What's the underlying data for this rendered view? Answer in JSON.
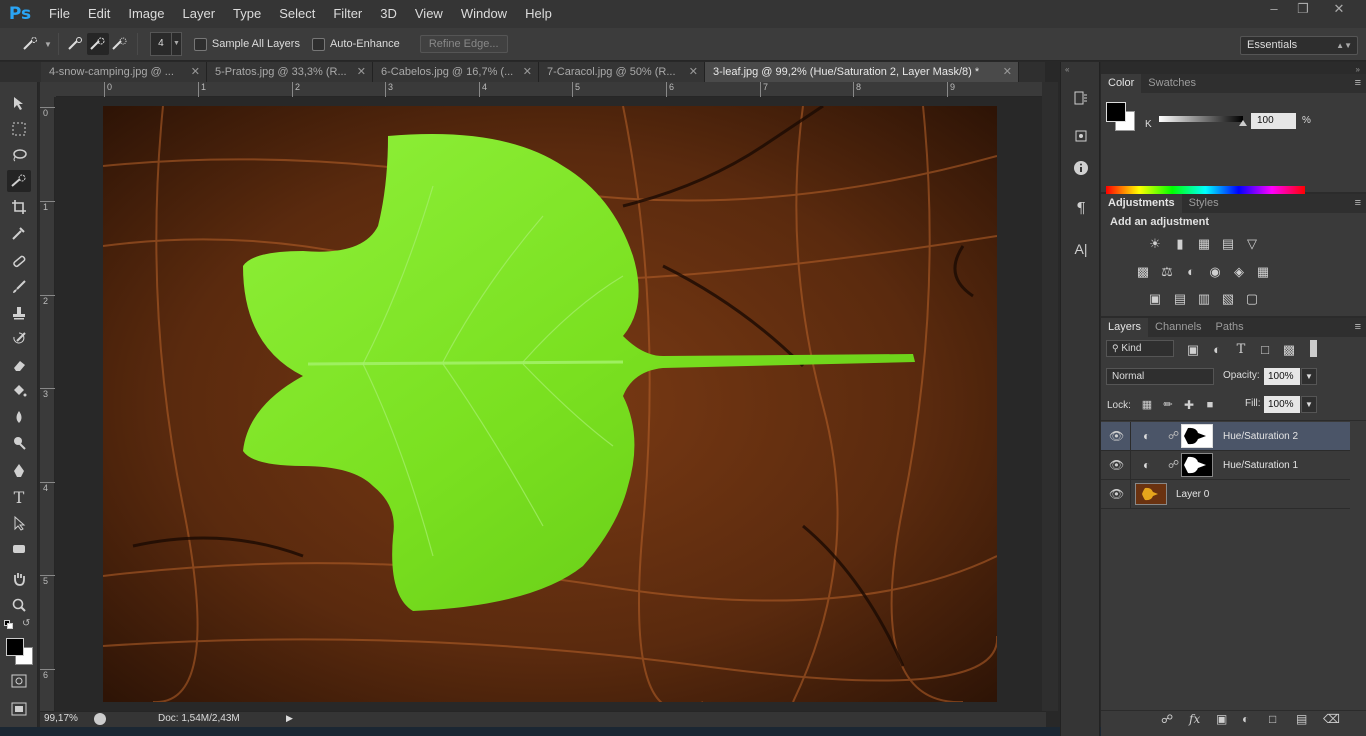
{
  "app": {
    "logo": "Ps"
  },
  "menu": [
    "File",
    "Edit",
    "Image",
    "Layer",
    "Type",
    "Select",
    "Filter",
    "3D",
    "View",
    "Window",
    "Help"
  ],
  "options": {
    "brush_size": "4",
    "sample_all_layers": "Sample All Layers",
    "auto_enhance": "Auto-Enhance",
    "refine_edge": "Refine Edge...",
    "workspace": "Essentials"
  },
  "tabs": [
    {
      "label": "4-snow-camping.jpg @ ..."
    },
    {
      "label": "5-Pratos.jpg @ 33,3% (R..."
    },
    {
      "label": "6-Cabelos.jpg @ 16,7% (..."
    },
    {
      "label": "7-Caracol.jpg @ 50% (R..."
    },
    {
      "label": "3-leaf.jpg @ 99,2% (Hue/Saturation 2, Layer Mask/8) *"
    }
  ],
  "ruler": {
    "h": [
      "0",
      "1",
      "2",
      "3",
      "4",
      "5",
      "6",
      "7",
      "8",
      "9"
    ],
    "v": [
      "0",
      "1",
      "2",
      "3",
      "4",
      "5",
      "6"
    ]
  },
  "status": {
    "zoom": "99,17%",
    "doc": "Doc: 1,54M/2,43M"
  },
  "color_panel": {
    "tabs": [
      "Color",
      "Swatches"
    ],
    "channel": "K",
    "value": "100",
    "unit": "%",
    "fg": "#000000",
    "bg": "#ffffff"
  },
  "adjust_panel": {
    "tabs": [
      "Adjustments",
      "Styles"
    ],
    "title": "Add an adjustment"
  },
  "layers_panel": {
    "tabs": [
      "Layers",
      "Channels",
      "Paths"
    ],
    "kind": "Kind",
    "blend": "Normal",
    "opacity_label": "Opacity:",
    "opacity": "100%",
    "lock_label": "Lock:",
    "fill_label": "Fill:",
    "fill": "100%",
    "layers": [
      {
        "name": "Hue/Saturation 2"
      },
      {
        "name": "Hue/Saturation 1"
      },
      {
        "name": "Layer 0"
      }
    ]
  }
}
